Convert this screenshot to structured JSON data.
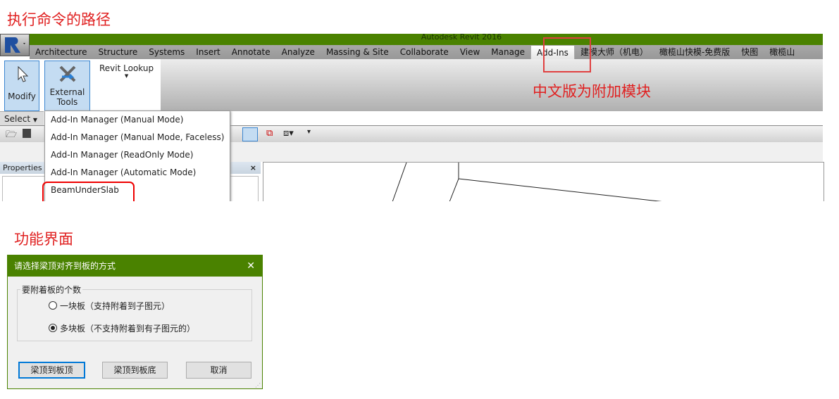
{
  "headings": {
    "path": "执行命令的路径",
    "ui": "功能界面",
    "annotation": "中文版为附加模块"
  },
  "window": {
    "title": "Autodesk Revit 2016"
  },
  "tabs": [
    "Architecture",
    "Structure",
    "Systems",
    "Insert",
    "Annotate",
    "Analyze",
    "Massing & Site",
    "Collaborate",
    "View",
    "Manage",
    "Add-Ins",
    "建模大师（机电）",
    "橄榄山快模-免费版",
    "快图",
    "橄榄山"
  ],
  "active_tab": "Add-Ins",
  "ribbon": {
    "modify": "Modify",
    "external_tools": [
      "External",
      "Tools"
    ],
    "revit_lookup": "Revit Lookup",
    "select_panel": "Select"
  },
  "menu": [
    "Add-In Manager (Manual Mode)",
    "Add-In Manager (Manual Mode, Faceless)",
    "Add-In Manager (ReadOnly Mode)",
    "Add-In Manager (Automatic Mode)",
    "BeamUnderSlab"
  ],
  "properties": {
    "title": "Properties",
    "close": "×"
  },
  "dialog": {
    "title": "请选择梁顶对齐到板的方式",
    "close": "✕",
    "group": "要附着板的个数",
    "options": [
      {
        "label": "一块板（支持附着到子图元）",
        "checked": false
      },
      {
        "label": "多块板（不支持附着到有子图元的）",
        "checked": true
      }
    ],
    "buttons": [
      "梁顶到板顶",
      "梁顶到板底",
      "取消"
    ]
  },
  "colors": {
    "titlebar": "#4a8200",
    "highlight": "#e02020",
    "selected": "#c4dcf2"
  }
}
